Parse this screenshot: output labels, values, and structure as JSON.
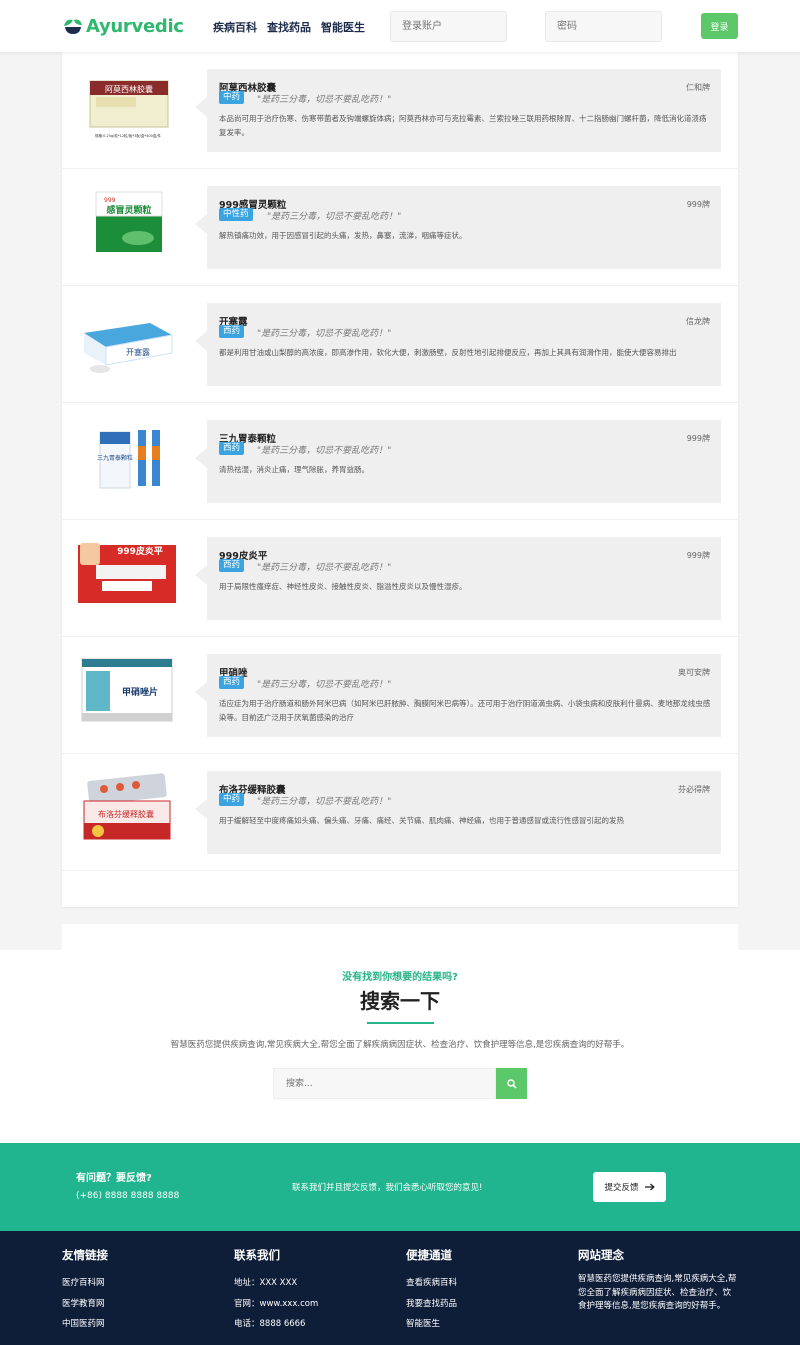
{
  "header": {
    "logo_text": "Ayurvedic",
    "nav": [
      "疾病百科",
      "查找药品",
      "智能医生"
    ],
    "account_placeholder": "登录账户",
    "password_placeholder": "密码",
    "login_label": "登录"
  },
  "drugs": [
    {
      "name": "阿莫西林胶囊",
      "brand": "仁和牌",
      "tag": "中药",
      "slogan": "\"是药三分毒，切忌不要乱吃药！\"",
      "desc": "本品尚可用于治疗伤寒、伤寒带菌者及钩端螺旋体病；阿莫西林亦可与克拉霉素、兰索拉唑三联用药根除胃、十二指肠幽门螺杆菌，降低消化道溃疡复发率。",
      "thumb_label": "阿莫西林胶囊",
      "thumb_caption": "规格:0.25g/粒*12粒/板*3板/盒*400盒/件"
    },
    {
      "name": "999感冒灵颗粒",
      "brand": "999牌",
      "tag": "中性药",
      "slogan": "\"是药三分毒，切忌不要乱吃药！\"",
      "desc": "解热镇痛功效，用于因感冒引起的头痛，发热，鼻塞，流涕，咽痛等症状。",
      "thumb_label": "感冒灵颗粒",
      "thumb_caption": "999"
    },
    {
      "name": "开塞露",
      "brand": "信龙牌",
      "tag": "西药",
      "slogan": "\"是药三分毒，切忌不要乱吃药！\"",
      "desc": "都是利用甘油或山梨醇的高浓度，即高渗作用，软化大便，刺激肠壁，反射性地引起排便反应，再加上其具有润滑作用，能使大便容易排出",
      "thumb_label": "开塞露",
      "thumb_caption": ""
    },
    {
      "name": "三九胃泰颗粒",
      "brand": "999牌",
      "tag": "西药",
      "slogan": "\"是药三分毒，切忌不要乱吃药！\"",
      "desc": "清热祛湿，消炎止痛，理气除胀，养胃益肠。",
      "thumb_label": "三九胃泰颗粒",
      "thumb_caption": ""
    },
    {
      "name": "999皮炎平",
      "brand": "999牌",
      "tag": "西药",
      "slogan": "\"是药三分毒，切忌不要乱吃药！\"",
      "desc": "用于局限性瘙痒症、神经性皮炎、接触性皮炎、脂溢性皮炎以及慢性湿疹。",
      "thumb_label": "999皮炎平",
      "thumb_caption": ""
    },
    {
      "name": "甲硝唑",
      "brand": "奥可安牌",
      "tag": "西药",
      "slogan": "\"是药三分毒，切忌不要乱吃药！\"",
      "desc": "适应症为用于治疗肠道和肠外阿米巴病（如阿米巴肝脓肿、胸膜阿米巴病等）。还可用于治疗阴道滴虫病、小袋虫病和皮肤利什曼病、麦地那龙线虫感染等。目前还广泛用于厌氧菌感染的治疗",
      "thumb_label": "甲硝唑片",
      "thumb_caption": ""
    },
    {
      "name": "布洛芬缓释胶囊",
      "brand": "芬必得牌",
      "tag": "中药",
      "slogan": "\"是药三分毒，切忌不要乱吃药！\"",
      "desc": "用于缓解轻至中度疼痛如头痛、偏头痛、牙痛、痛经、关节痛、肌肉痛、神经痛，也用于普通感冒或流行性感冒引起的发热",
      "thumb_label": "布洛芬缓释胶囊",
      "thumb_caption": ""
    }
  ],
  "search": {
    "subtitle": "没有找到你想要的结果吗?",
    "title": "搜索一下",
    "desc": "智慧医药您提供疾病查询,常见疾病大全,帮您全面了解疾病病因症状、检查治疗、饮食护理等信息,是您疾病查询的好帮手。",
    "placeholder": "搜索..."
  },
  "feedback": {
    "question": "有问题？要反馈?",
    "phone": "(+86) 8888 8888 8888",
    "middle": "联系我们并且提交反馈，我们会悉心听取您的意见!",
    "button": "提交反馈"
  },
  "footer": {
    "links": {
      "title": "友情链接",
      "items": [
        "医疗百科网",
        "医学教育网",
        "中国医药网"
      ]
    },
    "contact": {
      "title": "联系我们",
      "items": [
        "地址：XXX XXX",
        "官网：www.xxx.com",
        "电话：8888 6666"
      ]
    },
    "quick": {
      "title": "便捷通道",
      "items": [
        "查看疾病百科",
        "我要查找药品",
        "智能医生"
      ]
    },
    "idea": {
      "title": "网站理念",
      "text": "智慧医药您提供疾病查询,常见疾病大全,帮您全面了解疾病病因症状、检查治疗、饮食护理等信息,是您疾病查询的好帮手。"
    }
  },
  "colors": {
    "brand": "#2fb86e",
    "accent": "#20b58e",
    "tag": "#3ba3e0",
    "footer": "#0e1d38"
  }
}
